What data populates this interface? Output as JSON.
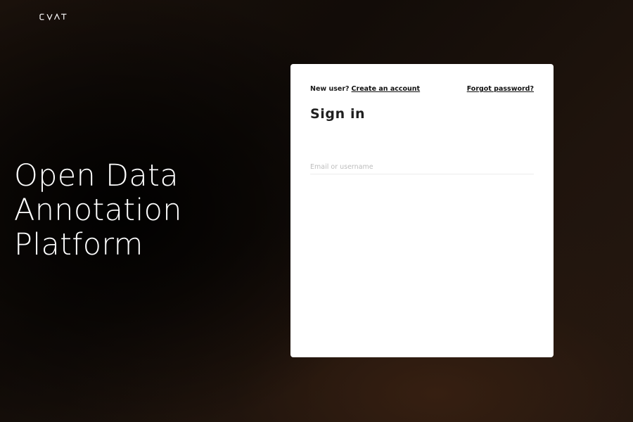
{
  "brand": {
    "logo_text": "CVAT",
    "logo_color": "#ffffff"
  },
  "hero": {
    "lines": [
      "Open Data",
      "Annotation",
      "Platform"
    ]
  },
  "signin": {
    "new_user_prompt": "New user?",
    "create_account_link": "Create an account",
    "forgot_password_link": "Forgot password?",
    "title": "Sign in",
    "email_placeholder": "Email or username",
    "email_value": ""
  },
  "colors": {
    "background": "#140d08",
    "card": "#ffffff",
    "text_dark": "#1f1f1f",
    "placeholder": "#bdbdbd"
  }
}
